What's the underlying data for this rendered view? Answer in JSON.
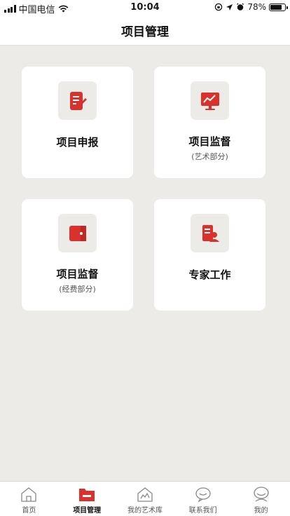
{
  "status_bar": {
    "carrier": "中国电信",
    "time": "10:04",
    "battery": "78%",
    "battery_level": 0.78
  },
  "header": {
    "title": "项目管理"
  },
  "cards": [
    {
      "title": "项目申报",
      "subtitle": "",
      "icon": "report-document-icon"
    },
    {
      "title": "项目监督",
      "subtitle": "(艺术部分)",
      "icon": "trend-monitor-icon"
    },
    {
      "title": "项目监督",
      "subtitle": "(经费部分)",
      "icon": "wallet-icon"
    },
    {
      "title": "专家工作",
      "subtitle": "",
      "icon": "expert-document-icon"
    }
  ],
  "tabs": [
    {
      "label": "首页",
      "icon": "home-icon",
      "active": false
    },
    {
      "label": "项目管理",
      "icon": "folder-icon",
      "active": true
    },
    {
      "label": "我的艺术库",
      "icon": "art-library-icon",
      "active": false
    },
    {
      "label": "联系我们",
      "icon": "chat-icon",
      "active": false
    },
    {
      "label": "我的",
      "icon": "profile-icon",
      "active": false
    }
  ],
  "colors": {
    "accent": "#d9312b",
    "background": "#edebe8",
    "card": "#ffffff"
  }
}
